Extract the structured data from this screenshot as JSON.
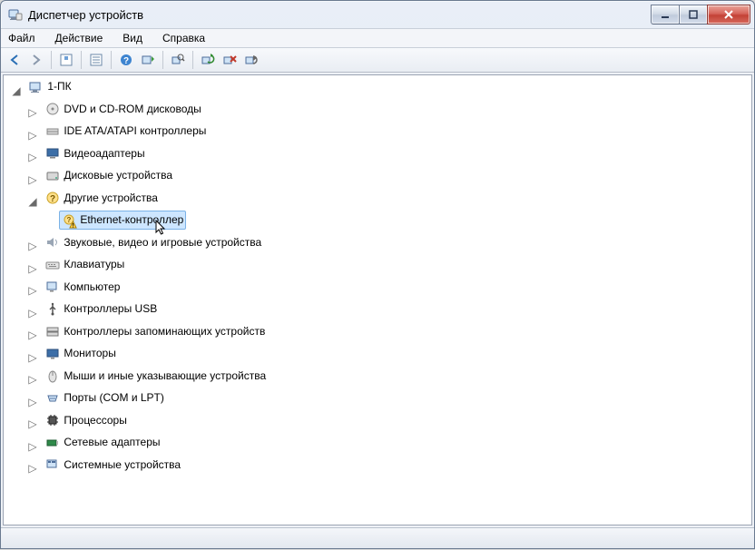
{
  "window": {
    "title": "Диспетчер устройств"
  },
  "menu": {
    "file": "Файл",
    "action": "Действие",
    "view": "Вид",
    "help": "Справка"
  },
  "toolbar_icons": {
    "back": "back-arrow-icon",
    "forward": "forward-arrow-icon",
    "up_show": "show-hidden-icon",
    "properties": "properties-icon",
    "help": "help-icon",
    "scan": "scan-hardware-icon",
    "find": "find-icon",
    "update": "update-driver-icon",
    "uninstall": "uninstall-icon",
    "disable": "disable-icon"
  },
  "tree": {
    "root": {
      "label": "1-ПК"
    },
    "items": [
      {
        "label": "DVD и CD-ROM дисководы"
      },
      {
        "label": "IDE ATA/ATAPI контроллеры"
      },
      {
        "label": "Видеоадаптеры"
      },
      {
        "label": "Дисковые устройства"
      },
      {
        "label": "Другие устройства",
        "expanded": true,
        "children": [
          {
            "label": "Ethernet-контроллер",
            "selected": true,
            "warning": true
          }
        ]
      },
      {
        "label": "Звуковые, видео и игровые устройства"
      },
      {
        "label": "Клавиатуры"
      },
      {
        "label": "Компьютер"
      },
      {
        "label": "Контроллеры USB"
      },
      {
        "label": "Контроллеры запоминающих устройств"
      },
      {
        "label": "Мониторы"
      },
      {
        "label": "Мыши и иные указывающие устройства"
      },
      {
        "label": "Порты (COM и LPT)"
      },
      {
        "label": "Процессоры"
      },
      {
        "label": "Сетевые адаптеры"
      },
      {
        "label": "Системные устройства"
      }
    ]
  }
}
